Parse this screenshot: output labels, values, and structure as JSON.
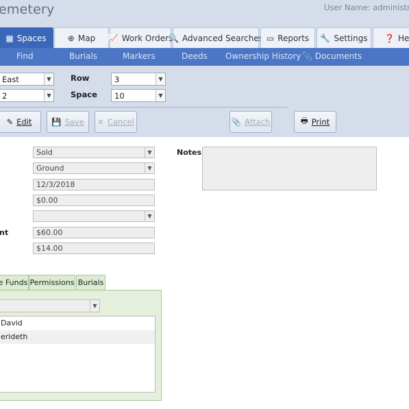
{
  "header": {
    "app_title": "emetery",
    "user_name": "User Name: administrat"
  },
  "main_tabs": [
    {
      "label": "Spaces",
      "icon": "grid-icon",
      "active": true
    },
    {
      "label": "Map",
      "icon": "globe-icon",
      "active": false
    },
    {
      "label": "Work Orders",
      "icon": "chart-icon",
      "active": false
    },
    {
      "label": "Advanced Searches",
      "icon": "search-icon",
      "active": false
    },
    {
      "label": "Reports",
      "icon": "document-icon",
      "active": false
    },
    {
      "label": "Settings",
      "icon": "wrench-icon",
      "active": false
    },
    {
      "label": "Help",
      "icon": "help-icon",
      "active": false
    }
  ],
  "sub_nav": [
    {
      "label": "Find"
    },
    {
      "label": "Burials"
    },
    {
      "label": "Markers"
    },
    {
      "label": "Deeds"
    },
    {
      "label": "Ownership History"
    },
    {
      "label": "Documents",
      "icon": "paperclip-icon"
    }
  ],
  "filters": {
    "section_value": "East",
    "lot_value": "2",
    "row_label": "Row",
    "row_value": "3",
    "space_label": "Space",
    "space_value": "10"
  },
  "toolbar": {
    "edit_label": "Edit",
    "save_label": "Save",
    "cancel_label": "Cancel",
    "attach_label": "Attach",
    "print_label": "Print"
  },
  "form": {
    "status_value": "Sold",
    "type_value": "Ground",
    "date_value": "12/3/2018",
    "price_value": "$0.00",
    "blank_select_value": "",
    "amount_label_partial": "nt",
    "amount_value": "$60.00",
    "fee_value": "$14.00",
    "notes_label": "Notes",
    "notes_value": ""
  },
  "bottom_tabs": [
    {
      "label": "e Funds"
    },
    {
      "label": "Permissions"
    },
    {
      "label": "Burials"
    }
  ],
  "panel": {
    "select_value": "",
    "list_items": [
      {
        "label": "David"
      },
      {
        "label": "erideth"
      }
    ]
  }
}
